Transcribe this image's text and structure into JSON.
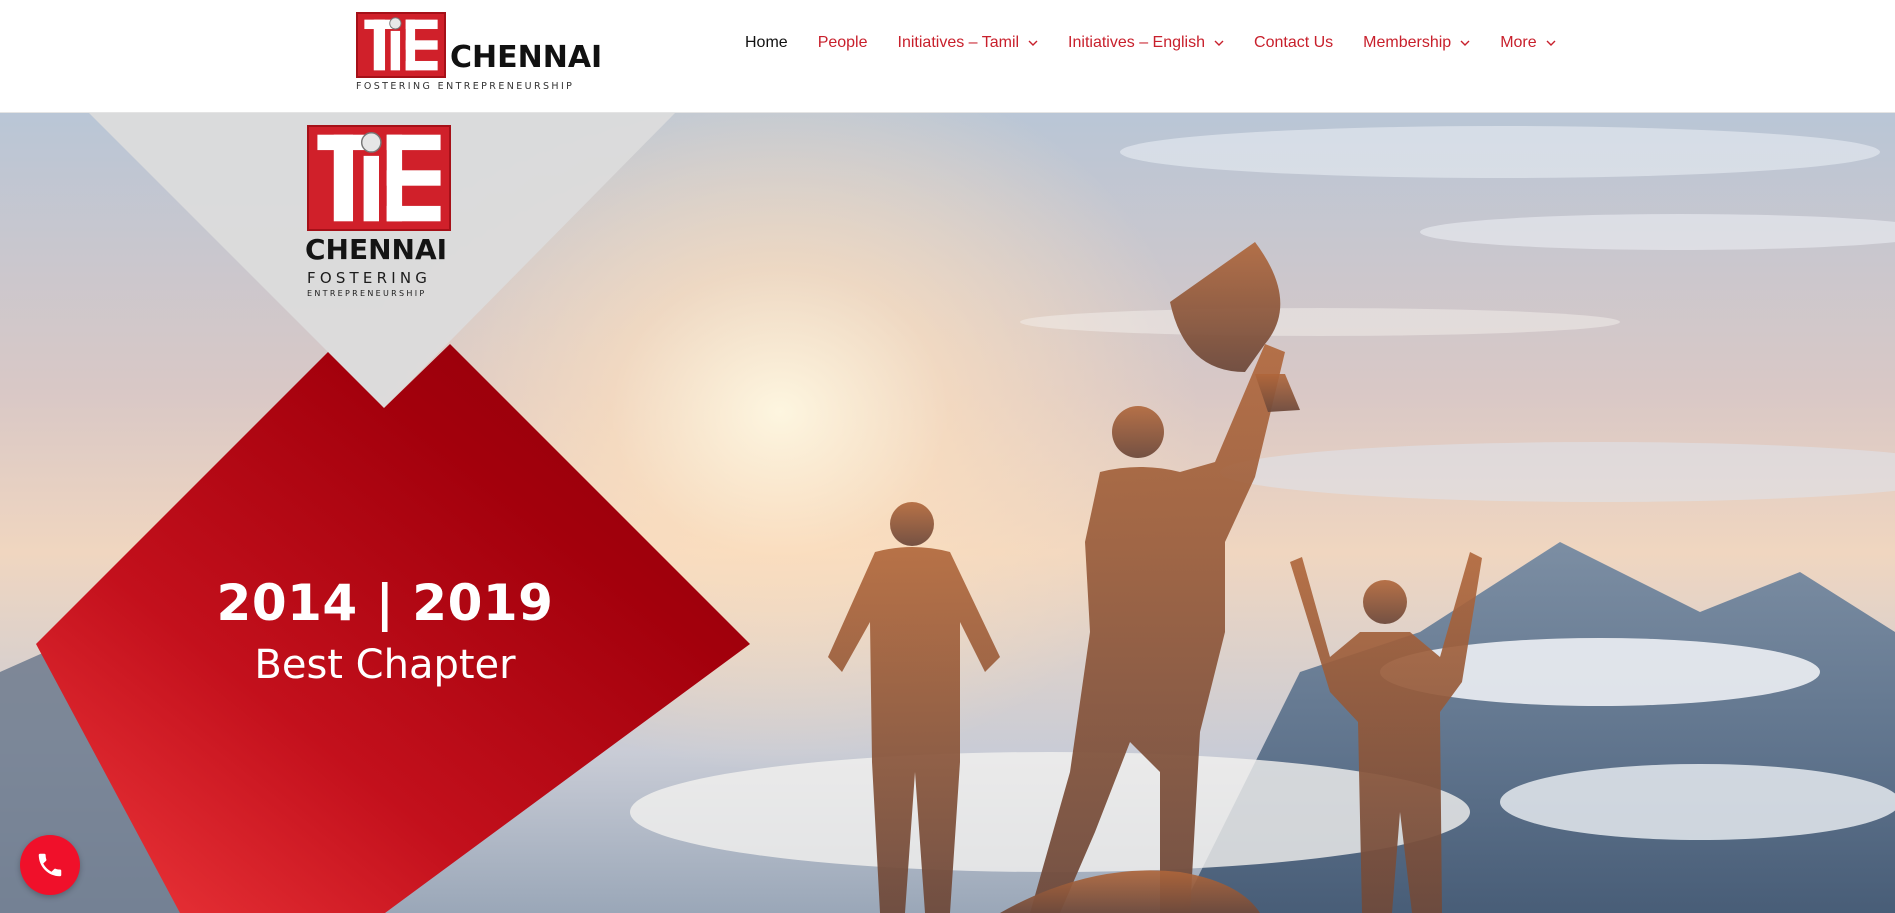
{
  "header": {
    "logo": {
      "mark_text": "TiE",
      "word": "CHENNAI",
      "tagline": "FOSTERING ENTREPRENEURSHIP",
      "brand_red": "#d0202a"
    },
    "nav": [
      {
        "label": "Home",
        "active": true,
        "dropdown": false
      },
      {
        "label": "People",
        "active": false,
        "dropdown": false
      },
      {
        "label": "Initiatives – Tamil",
        "active": false,
        "dropdown": true
      },
      {
        "label": "Initiatives – English",
        "active": false,
        "dropdown": true
      },
      {
        "label": "Contact Us",
        "active": false,
        "dropdown": false
      },
      {
        "label": "Membership",
        "active": false,
        "dropdown": true
      },
      {
        "label": "More",
        "active": false,
        "dropdown": true
      }
    ],
    "nav_color": "#c8202c",
    "nav_active_color": "#111111"
  },
  "hero": {
    "panel_logo": {
      "mark_text": "TiE",
      "word": "CHENNAI",
      "line1": "FOSTERING",
      "line2": "ENTREPRENEURSHIP"
    },
    "award": {
      "years": "2014 | 2019",
      "title": "Best Chapter"
    },
    "diamond_color": "#a3000c",
    "panel_color": "#d9d9d9"
  },
  "call_button": {
    "icon": "phone-icon",
    "color": "#f0102a"
  }
}
